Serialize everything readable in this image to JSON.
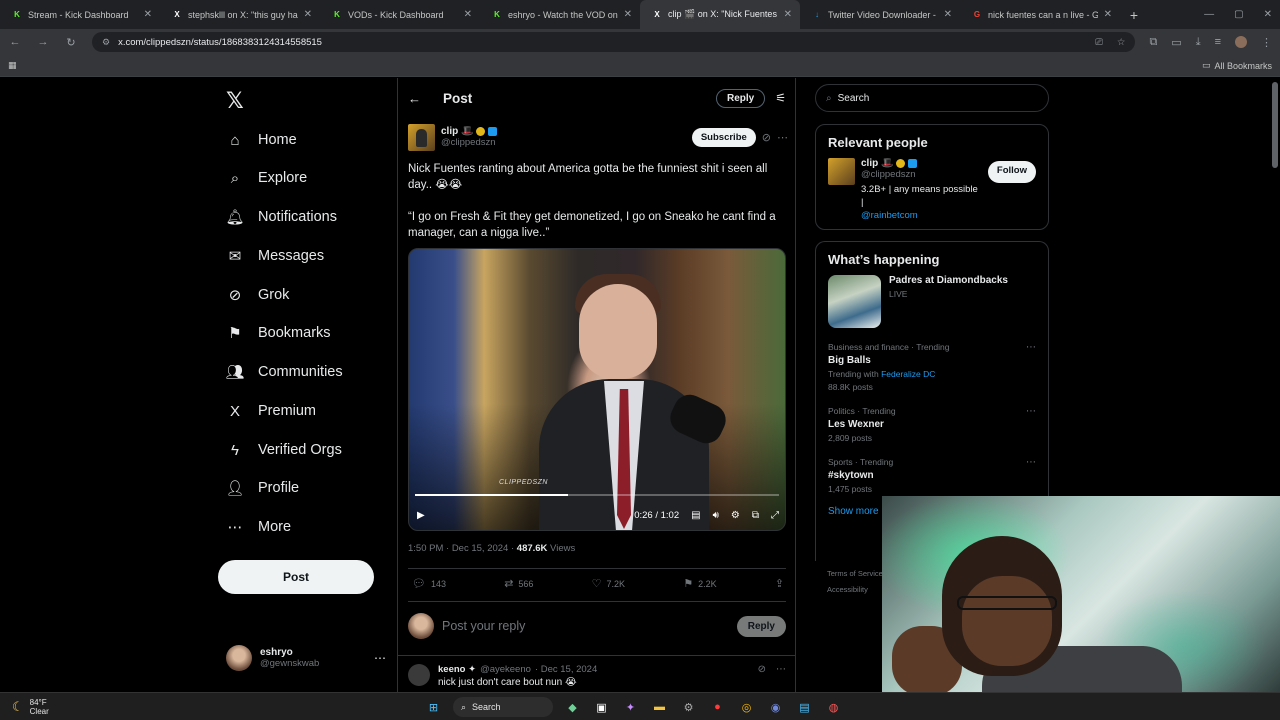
{
  "browser": {
    "tabs": [
      {
        "title": "Stream - Kick Dashboard",
        "favicon": "K",
        "color": "#53fc18",
        "active": false
      },
      {
        "title": "stephsklll on X: \"this guy had h",
        "favicon": "X",
        "color": "#ffffff",
        "active": false
      },
      {
        "title": "VODs - Kick Dashboard",
        "favicon": "K",
        "color": "#53fc18",
        "active": false
      },
      {
        "title": "eshryo - Watch the VOD on Ki",
        "favicon": "K",
        "color": "#53fc18",
        "active": false
      },
      {
        "title": "clip 🎬 on X: \"Nick Fuentes ran",
        "favicon": "X",
        "color": "#ffffff",
        "active": true
      },
      {
        "title": "Twitter Video Downloader - Do",
        "favicon": "↓",
        "color": "#1d9bf0",
        "active": false
      },
      {
        "title": "nick fuentes can a n live - Goo",
        "favicon": "G",
        "color": "#ea4335",
        "active": false
      }
    ],
    "url": "x.com/clippedszn/status/1868383124314558515",
    "bookmarks_label": "All Bookmarks"
  },
  "nav": {
    "items": [
      {
        "label": "Home",
        "icon": "⌂",
        "name": "home"
      },
      {
        "label": "Explore",
        "icon": "⌕",
        "name": "explore"
      },
      {
        "label": "Notifications",
        "icon": "🔔︎",
        "name": "notifications"
      },
      {
        "label": "Messages",
        "icon": "✉",
        "name": "messages"
      },
      {
        "label": "Grok",
        "icon": "⊘",
        "name": "grok"
      },
      {
        "label": "Bookmarks",
        "icon": "⚑",
        "name": "bookmarks"
      },
      {
        "label": "Communities",
        "icon": "👥︎",
        "name": "communities"
      },
      {
        "label": "Premium",
        "icon": "X",
        "name": "premium"
      },
      {
        "label": "Verified Orgs",
        "icon": "ϟ",
        "name": "verified-orgs"
      },
      {
        "label": "Profile",
        "icon": "👤︎",
        "name": "profile"
      },
      {
        "label": "More",
        "icon": "⋯",
        "name": "more"
      }
    ],
    "post_button": "Post",
    "user": {
      "name": "eshryo",
      "handle": "@gewnskwab"
    }
  },
  "main": {
    "header_title": "Post",
    "reply_button": "Reply",
    "tweet": {
      "author_name": "clip 🎩",
      "author_handle": "@clippedszn",
      "subscribe_label": "Subscribe",
      "text_line1": "Nick Fuentes ranting about America gotta be the funniest shit i seen all day.. 😭😭",
      "text_line2": "“I go on Fresh & Fit they get demonetized, I go on Sneako he cant find a manager, can a nigga live..”",
      "video_watermark": "CLIPPEDSZN",
      "video_time": "0:26 / 1:02",
      "video_progress": 0.42,
      "timestamp": "1:50 PM · Dec 15, 2024 · ",
      "views_count": "487.6K",
      "views_label": " Views",
      "replies": "143",
      "reposts": "566",
      "likes": "7.2K",
      "bookmarks": "2.2K"
    },
    "reply_placeholder": "Post your reply",
    "reply_submit": "Reply",
    "first_reply": {
      "name": "keeno ✦",
      "handle": "@ayekeeno",
      "date": "· Dec 15, 2024",
      "text": "nick just don't care bout nun 😭"
    }
  },
  "right": {
    "search_placeholder": "Search",
    "relevant_title": "Relevant people",
    "relevant_person": {
      "name": "clip 🎩",
      "handle": "@clippedszn",
      "bio": "3.2B+ | any means possible | ",
      "bio_link": "@rainbetcom",
      "follow_label": "Follow"
    },
    "happening_title": "What’s happening",
    "happening_event": {
      "title": "Padres at Diamondbacks",
      "status": "LIVE"
    },
    "trends": [
      {
        "category": "Business and finance · Trending",
        "name": "Big Balls",
        "sub_prefix": "Trending with ",
        "sub_link": "Federalize DC",
        "count": "88.8K posts"
      },
      {
        "category": "Politics · Trending",
        "name": "Les Wexner",
        "sub_prefix": "",
        "sub_link": "",
        "count": "2,809 posts"
      },
      {
        "category": "Sports · Trending",
        "name": "#skytown",
        "sub_prefix": "",
        "sub_link": "",
        "count": "1,475 posts"
      }
    ],
    "show_more": "Show more",
    "footer_line1": "Terms of Service",
    "footer_line2": "Accessibility"
  },
  "taskbar": {
    "temperature": "84°F",
    "condition": "Clear",
    "search_label": "Search"
  }
}
